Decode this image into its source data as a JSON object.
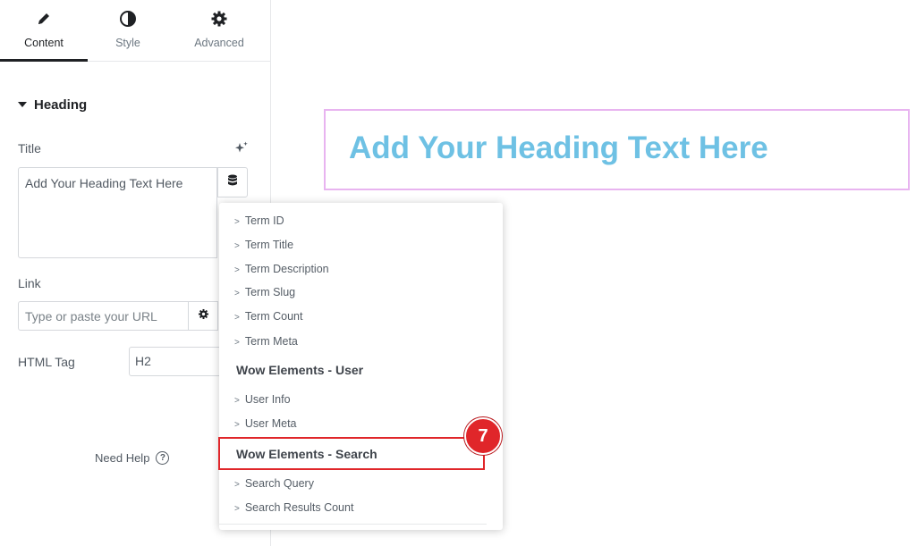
{
  "tabs": [
    {
      "label": "Content",
      "icon": "pencil-icon",
      "active": true
    },
    {
      "label": "Style",
      "icon": "half-circle-icon",
      "active": false
    },
    {
      "label": "Advanced",
      "icon": "gear-icon",
      "active": false
    }
  ],
  "section": {
    "title": "Heading"
  },
  "title_field": {
    "label": "Title",
    "value": "Add Your Heading Text Here"
  },
  "link_field": {
    "label": "Link",
    "placeholder": "Type or paste your URL"
  },
  "html_tag": {
    "label": "HTML Tag",
    "value": "H2"
  },
  "help": {
    "label": "Need Help"
  },
  "preview": {
    "heading": "Add Your Heading Text Here",
    "color": "#6ec1e4"
  },
  "dropdown": {
    "chev": ">",
    "items_term": [
      "Term ID",
      "Term Title",
      "Term Description",
      "Term Slug",
      "Term Count",
      "Term Meta"
    ],
    "group_user": "Wow Elements - User",
    "items_user": [
      "User Info",
      "User Meta"
    ],
    "group_search": "Wow Elements - Search",
    "items_search": [
      "Search Query",
      "Search Results Count"
    ]
  },
  "annotation": {
    "step": "7",
    "color": "#e0262a"
  }
}
